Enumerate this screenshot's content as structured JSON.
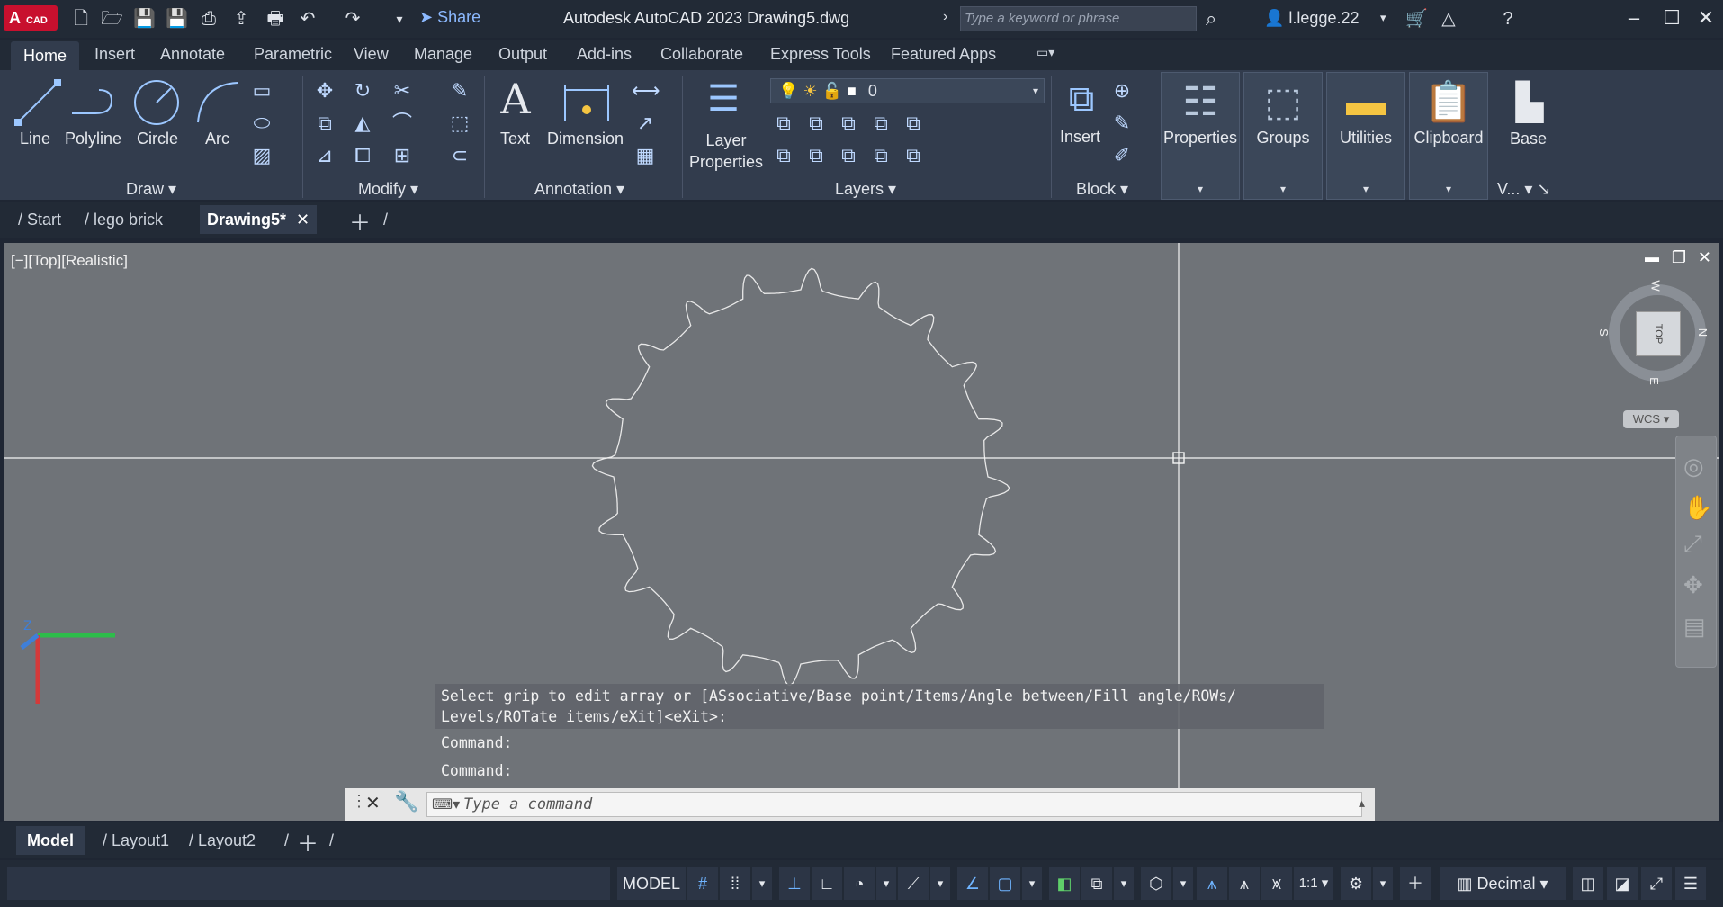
{
  "app": {
    "logo": "A",
    "logo_sub": "CAD",
    "title": "Autodesk AutoCAD 2023    Drawing5.dwg",
    "share_label": "Share",
    "search_placeholder": "Type a keyword or phrase",
    "user_name": "l.legge.22"
  },
  "ribbon_tabs": [
    "Home",
    "Insert",
    "Annotate",
    "Parametric",
    "View",
    "Manage",
    "Output",
    "Add-ins",
    "Collaborate",
    "Express Tools",
    "Featured Apps"
  ],
  "ribbon": {
    "draw": {
      "line": "Line",
      "polyline": "Polyline",
      "circle": "Circle",
      "arc": "Arc",
      "panel": "Draw"
    },
    "modify": {
      "panel": "Modify"
    },
    "annotation": {
      "text": "Text",
      "dimension": "Dimension",
      "panel": "Annotation"
    },
    "layers": {
      "layer_properties_1": "Layer",
      "layer_properties_2": "Properties",
      "current_layer": "0",
      "panel": "Layers"
    },
    "block": {
      "insert": "Insert",
      "panel": "Block"
    },
    "properties": "Properties",
    "groups": "Groups",
    "utilities": "Utilities",
    "clipboard": "Clipboard",
    "base": "Base",
    "view_panel": "V..."
  },
  "doc_tabs": [
    "Start",
    "lego brick",
    "Drawing5*"
  ],
  "viewport": {
    "label": "[−][Top][Realistic]",
    "viewcube_face": "TOP",
    "compass": {
      "n": "N",
      "s": "S",
      "e": "E",
      "w": "W"
    },
    "wcs": "WCS"
  },
  "command": {
    "history_1": "Select grip to edit array or [ASsociative/Base point/Items/Angle between/Fill angle/ROWs/",
    "history_2": "Levels/ROTate items/eXit]<eXit>:",
    "history_3": "Command:",
    "history_4": "Command:",
    "placeholder": "Type a command"
  },
  "layout_tabs": [
    "Model",
    "Layout1",
    "Layout2"
  ],
  "status": {
    "model": "MODEL",
    "scale": "1:1",
    "units": "Decimal"
  }
}
